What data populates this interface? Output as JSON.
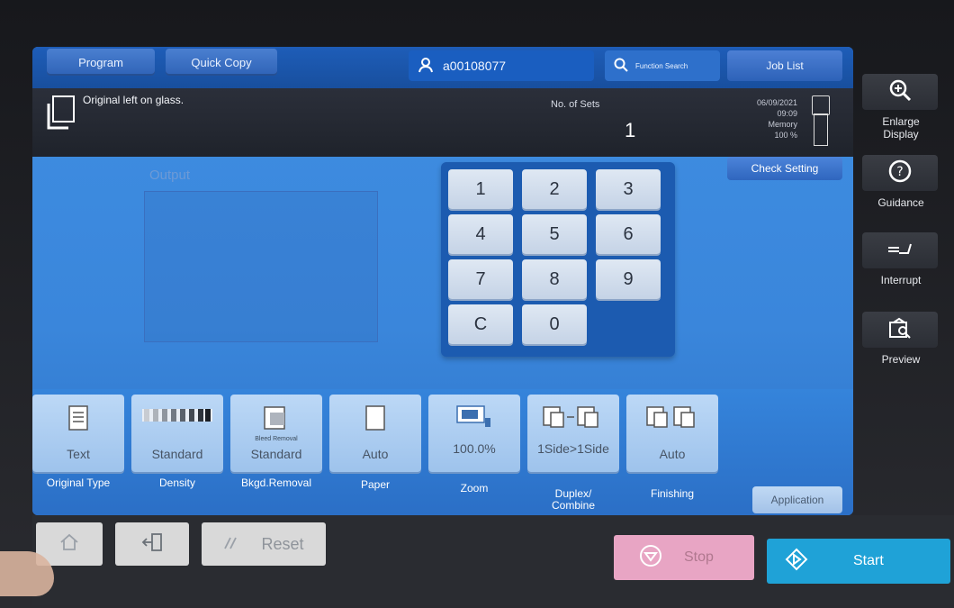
{
  "top": {
    "tab_program": "Program",
    "tab_quick_copy": "Quick Copy",
    "user_id": "a00108077",
    "search_label": "Function Search",
    "job_list": "Job List"
  },
  "info": {
    "message": "Original left on glass.",
    "sets_label": "No. of Sets",
    "sets_value": "1",
    "date": "06/09/2021",
    "time": "09:09",
    "memory_label": "Memory",
    "memory_value": "100 %"
  },
  "main": {
    "check_setting": "Check Setting",
    "output_label": "Output",
    "keypad": [
      "1",
      "2",
      "3",
      "4",
      "5",
      "6",
      "7",
      "8",
      "9",
      "C",
      "0"
    ]
  },
  "functions": [
    {
      "value": "Text",
      "label": "Original Type"
    },
    {
      "value": "Standard",
      "label": "Density"
    },
    {
      "sub": "Bleed Removal",
      "value": "Standard",
      "label": "Bkgd.Removal"
    },
    {
      "value": "Auto",
      "label": "Paper"
    },
    {
      "value": "100.0%",
      "label": "Zoom"
    },
    {
      "value": "1Side>1Side",
      "label": "Duplex/\nCombine"
    },
    {
      "value": "Auto",
      "label": "Finishing"
    }
  ],
  "application": "Application",
  "sidebar": {
    "enlarge": "Enlarge\nDisplay",
    "guidance": "Guidance",
    "interrupt": "Interrupt",
    "preview": "Preview"
  },
  "bottom": {
    "reset": "Reset",
    "stop": "Stop",
    "start": "Start"
  },
  "colors": {
    "screen_blue": "#3f8ee2",
    "stop_pink": "#e8a5c4",
    "start_blue": "#1fa2d7"
  }
}
